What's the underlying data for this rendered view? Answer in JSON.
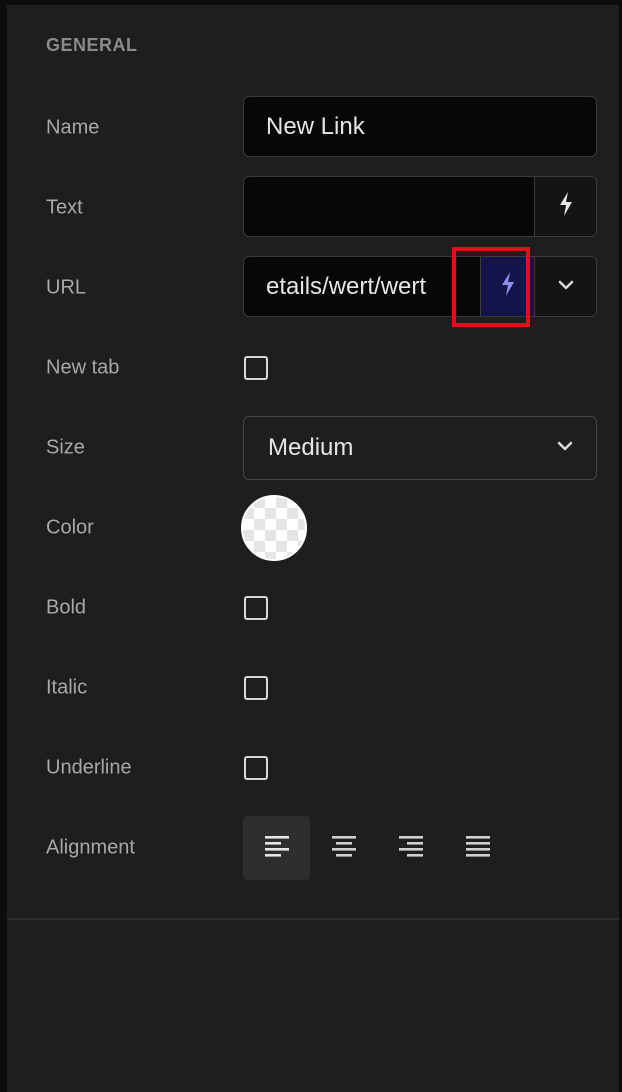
{
  "section": {
    "title": "GENERAL"
  },
  "fields": {
    "name": {
      "label": "Name",
      "value": "New Link"
    },
    "text": {
      "label": "Text",
      "value": ""
    },
    "url": {
      "label": "URL",
      "value": "etails/wert/wert"
    },
    "new_tab": {
      "label": "New tab",
      "checked": false
    },
    "size": {
      "label": "Size",
      "value": "Medium"
    },
    "color": {
      "label": "Color",
      "value": "transparent"
    },
    "bold": {
      "label": "Bold",
      "checked": false
    },
    "italic": {
      "label": "Italic",
      "checked": false
    },
    "underline": {
      "label": "Underline",
      "checked": false
    },
    "alignment": {
      "label": "Alignment",
      "selected": "left",
      "options": [
        "left",
        "center",
        "right",
        "justify"
      ]
    }
  },
  "icons": {
    "dynamic": "lightning-bolt-icon",
    "dropdown": "chevron-down-icon"
  },
  "colors": {
    "panel_bg": "#1e1e1e",
    "input_bg": "#070707",
    "active_addon_bg": "#14144a",
    "highlight": "#e0101a",
    "bolt_active": "#8f8ff0"
  }
}
